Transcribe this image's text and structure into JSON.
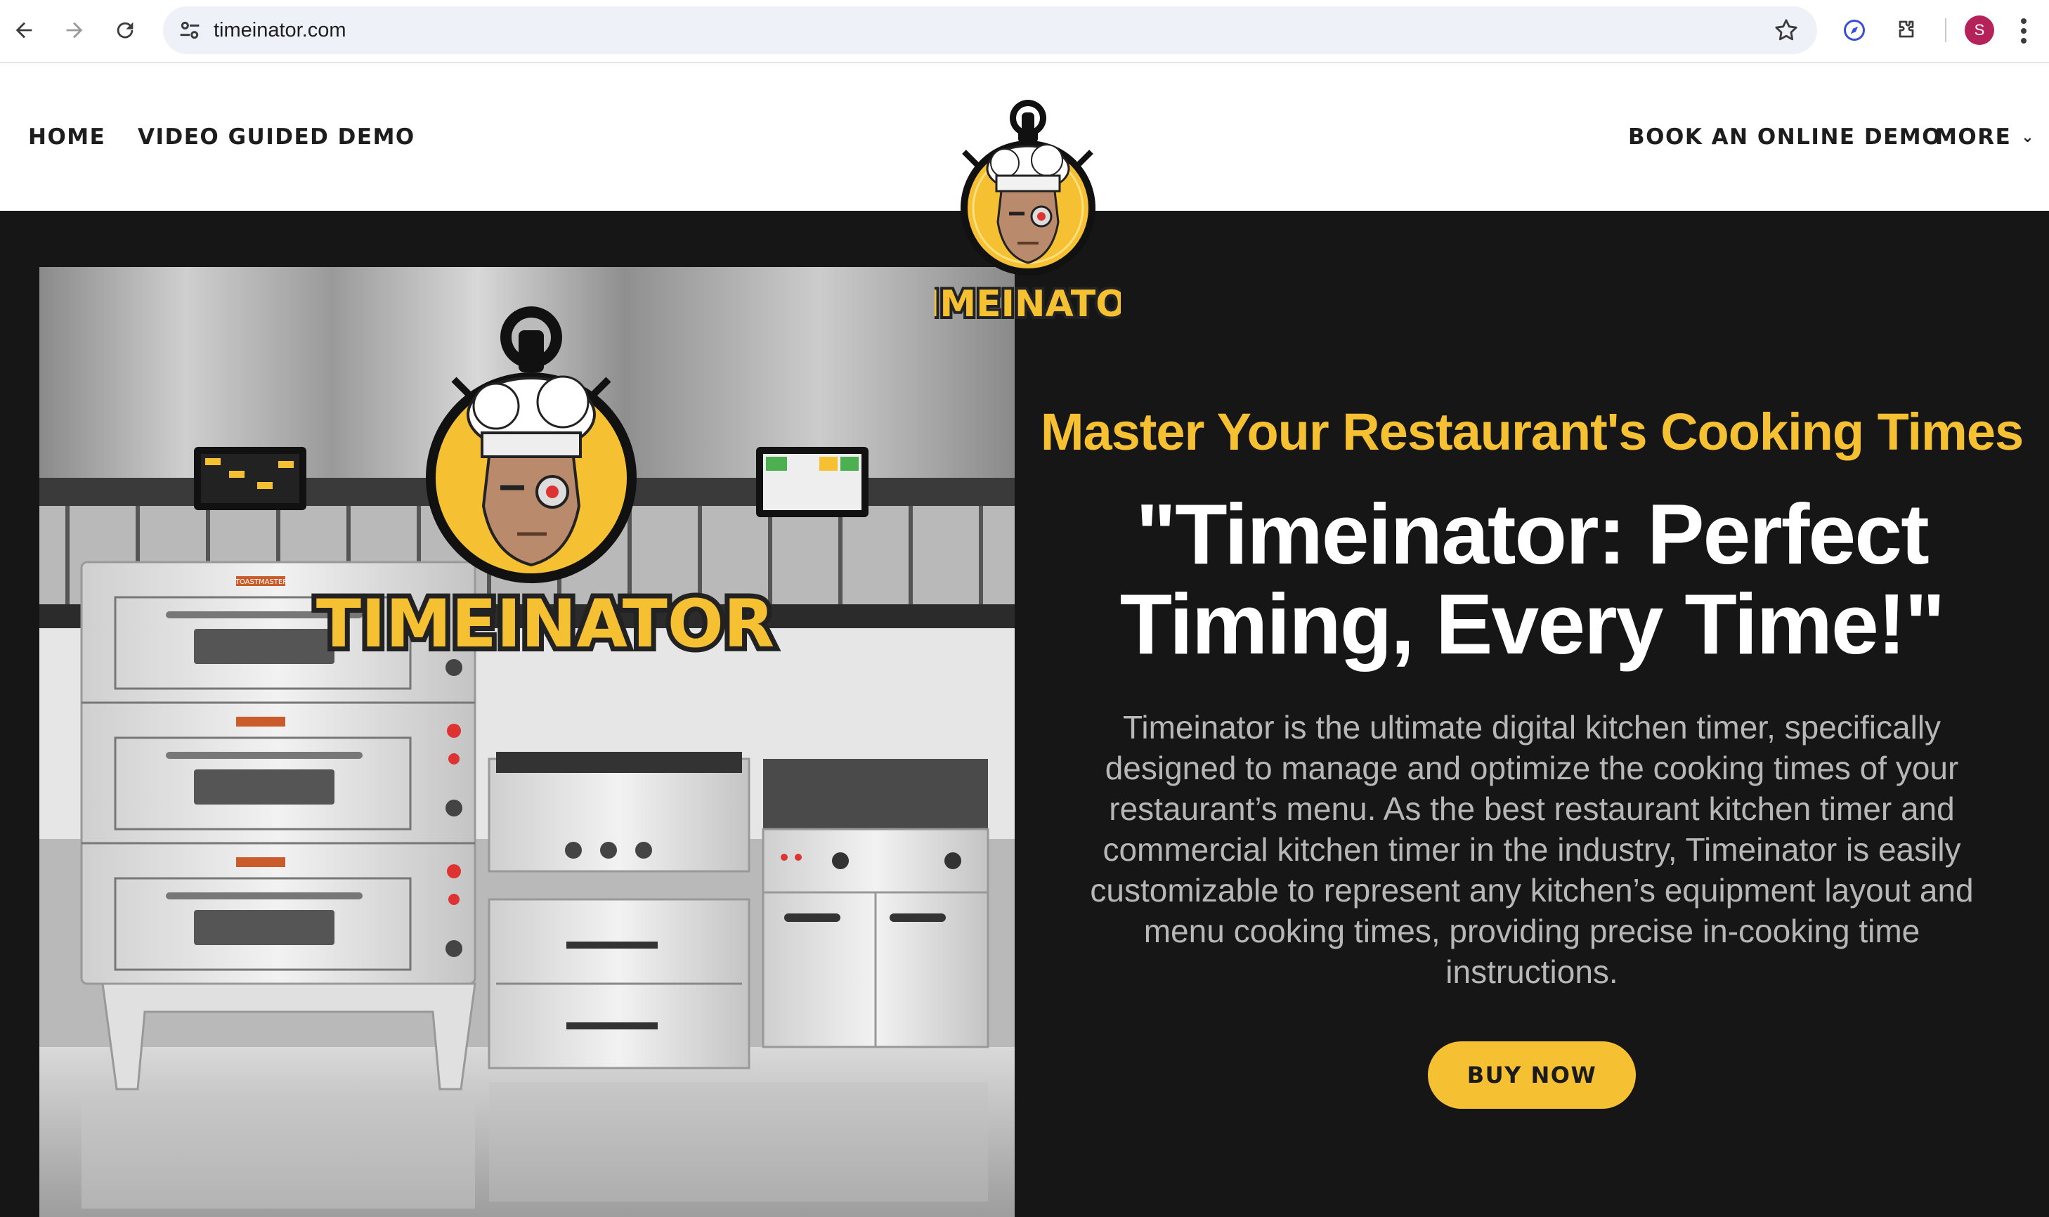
{
  "browser": {
    "url": "timeinator.com",
    "profile_initial": "S",
    "icons": [
      "back-arrow-icon",
      "forward-arrow-icon",
      "reload-icon",
      "site-settings-icon",
      "bookmark-star-icon",
      "extension-compass-icon",
      "extensions-puzzle-icon",
      "more-vertical-icon"
    ]
  },
  "nav": {
    "home": "HOME",
    "video_demo": "VIDEO GUIDED DEMO",
    "book_demo": "BOOK AN ONLINE DEMO",
    "more": "MORE"
  },
  "logo": {
    "wordmark": "TIMEINATOR"
  },
  "hero": {
    "kicker": "Master Your Restaurant's Cooking Times",
    "headline": "\"Timeinator: Perfect Timing, Every Time!\"",
    "description": "Timeinator is the ultimate digital kitchen timer, specifically designed to manage and optimize the cooking times of your restaurant’s menu. As the best restaurant kitchen timer and commercial kitchen timer in the industry, Timeinator is easily customizable to represent any kitchen’s equipment layout and menu cooking times, providing precise in-cooking time instructions.",
    "cta": "BUY NOW",
    "image_wordmark": "TIMEINATOR",
    "oven_badge": "TOASTMASTER"
  },
  "colors": {
    "accent": "#f5c032",
    "hero_bg": "#161616",
    "header_bg": "#ffffff",
    "description_text": "#b7b7b7"
  }
}
